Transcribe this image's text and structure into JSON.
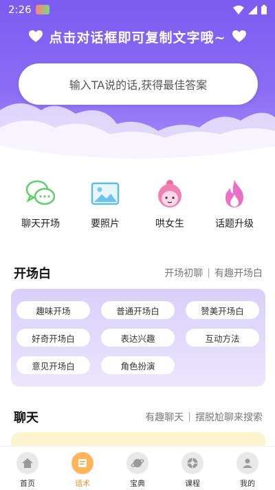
{
  "status_bar": {
    "time": "2:26"
  },
  "header": {
    "title": "点击对话框即可复制文字哦~",
    "search_placeholder": "输入TA说的话,获得最佳答案"
  },
  "categories": [
    {
      "label": "聊天开场",
      "icon": "chat-bubbles-icon"
    },
    {
      "label": "要照片",
      "icon": "photo-icon"
    },
    {
      "label": "哄女生",
      "icon": "girl-face-icon"
    },
    {
      "label": "话题升级",
      "icon": "flame-icon"
    }
  ],
  "opener_section": {
    "title": "开场白",
    "links": [
      "开场初聊",
      "有趣开场白"
    ],
    "chips": [
      "趣味开场",
      "普通开场白",
      "赞美开场白",
      "好奇开场白",
      "表达兴趣",
      "互动方法",
      "意见开场白",
      "角色扮演"
    ]
  },
  "chat_section": {
    "title": "聊天",
    "links": [
      "有趣聊天",
      "摆脱尬聊来搜索"
    ]
  },
  "bottom_nav": [
    {
      "label": "首页",
      "icon": "home-icon",
      "active": false
    },
    {
      "label": "话术",
      "icon": "script-icon",
      "active": true
    },
    {
      "label": "宝典",
      "icon": "planet-icon",
      "active": false
    },
    {
      "label": "课程",
      "icon": "course-icon",
      "active": false
    },
    {
      "label": "我的",
      "icon": "profile-icon",
      "active": false
    }
  ],
  "colors": {
    "header_purple": "#7b5cf0",
    "opener_card": "#d9cffb",
    "chat_card": "#fcf3cf",
    "active_tab": "#ff8a1c"
  }
}
